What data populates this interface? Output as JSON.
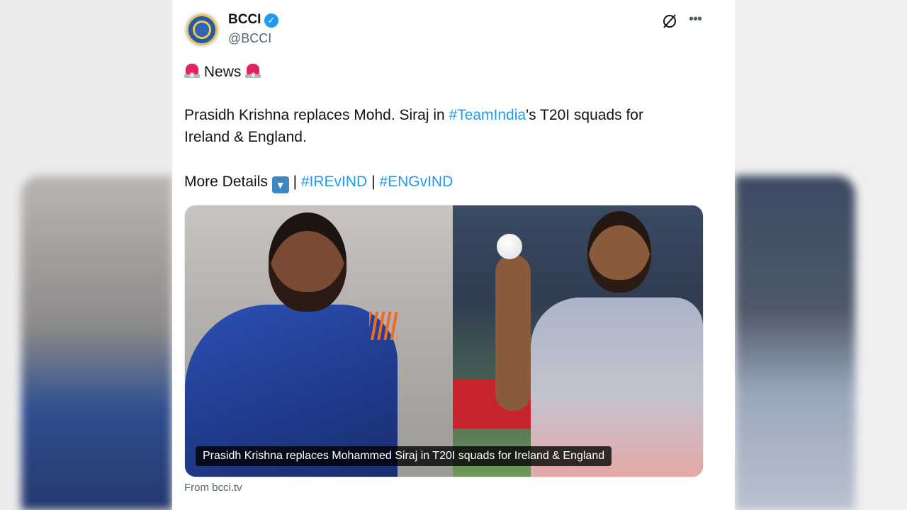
{
  "account": {
    "name": "BCCI",
    "handle": "@BCCI"
  },
  "tweet": {
    "line1_text": "News",
    "line2_part1": "Prasidh Krishna replaces Mohd. Siraj in ",
    "line2_hashtag": "#TeamIndia",
    "line2_part2": "'s T20I squads for",
    "line3": "Ireland & England.",
    "line4_text": "More Details",
    "line4_sep1": "|",
    "hashtag_ire": "#IREvIND",
    "line4_sep2": "|",
    "hashtag_eng": "#ENGvIND"
  },
  "media": {
    "caption": "Prasidh Krishna replaces Mohammed Siraj in T20I squads for Ireland & England"
  },
  "source": "From bcci.tv",
  "icons": [
    "verified-badge-icon",
    "grok-icon",
    "more-options-icon",
    "siren-icon",
    "down-arrow-icon"
  ],
  "colors": {
    "link": "#1d9bf0",
    "text": "#0f1419",
    "muted": "#536471",
    "verified": "#1d9bf0"
  }
}
